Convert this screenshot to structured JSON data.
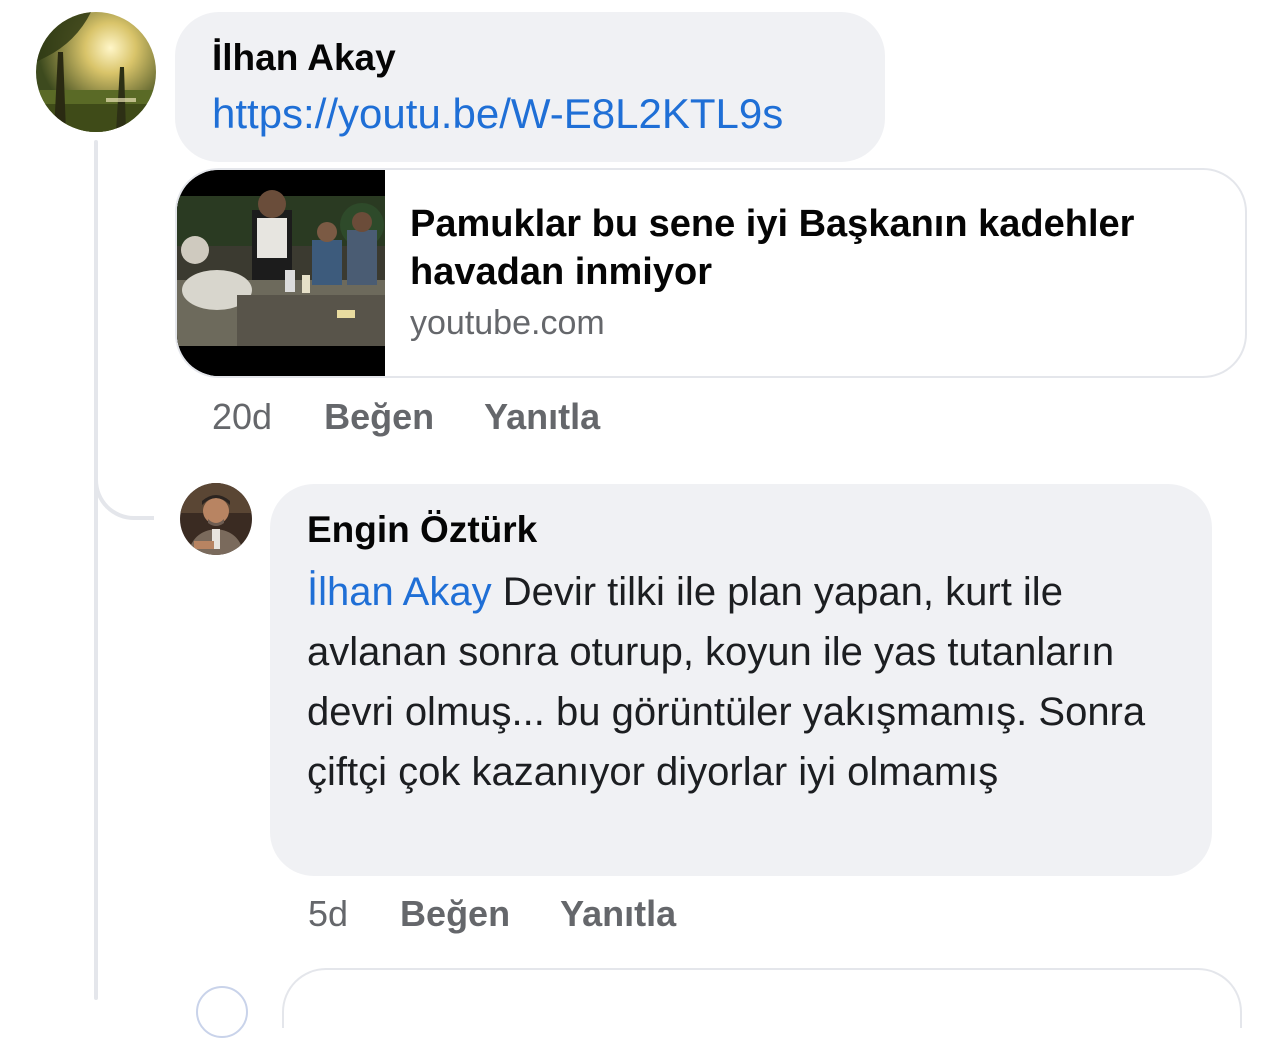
{
  "comments": [
    {
      "author": "İlhan Akay",
      "link": "https://youtu.be/W-E8L2KTL9s",
      "preview": {
        "title": "Pamuklar bu sene iyi Başkanın kadehler havadan inmiyor",
        "domain": "youtube.com"
      },
      "time": "20d",
      "like_label": "Beğen",
      "reply_label": "Yanıtla"
    },
    {
      "author": "Engin Öztürk",
      "mention": "İlhan Akay",
      "text": "Devir tilki ile plan yapan, kurt ile avlanan sonra oturup, koyun ile yas tutanların devri olmuş... bu görüntüler yakışmamış. Sonra çiftçi çok kazanıyor diyorlar iyi olmamış",
      "time": "5d",
      "like_label": "Beğen",
      "reply_label": "Yanıtla"
    }
  ],
  "colors": {
    "bubble": "#f0f1f4",
    "link": "#1f6fd6",
    "meta": "#65676b",
    "thread_line": "#e4e6eb"
  }
}
